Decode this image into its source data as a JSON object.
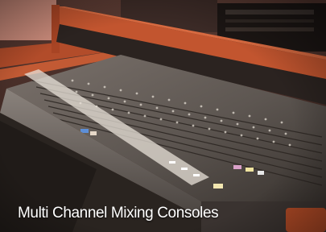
{
  "photo": {
    "subject": "multi-channel-mixing-console-photo",
    "palette": {
      "wood_frame": "#c2552f",
      "wall": "#8a5a48",
      "console_body": "#6a625c",
      "console_dark": "#2a2420",
      "fader_strip_light": "#e8e2d8",
      "led_blue": "#5d8fd8",
      "chair": "#b04a26"
    }
  },
  "caption": {
    "text": "Multi Channel Mixing Consoles",
    "color": "#ffffff"
  }
}
